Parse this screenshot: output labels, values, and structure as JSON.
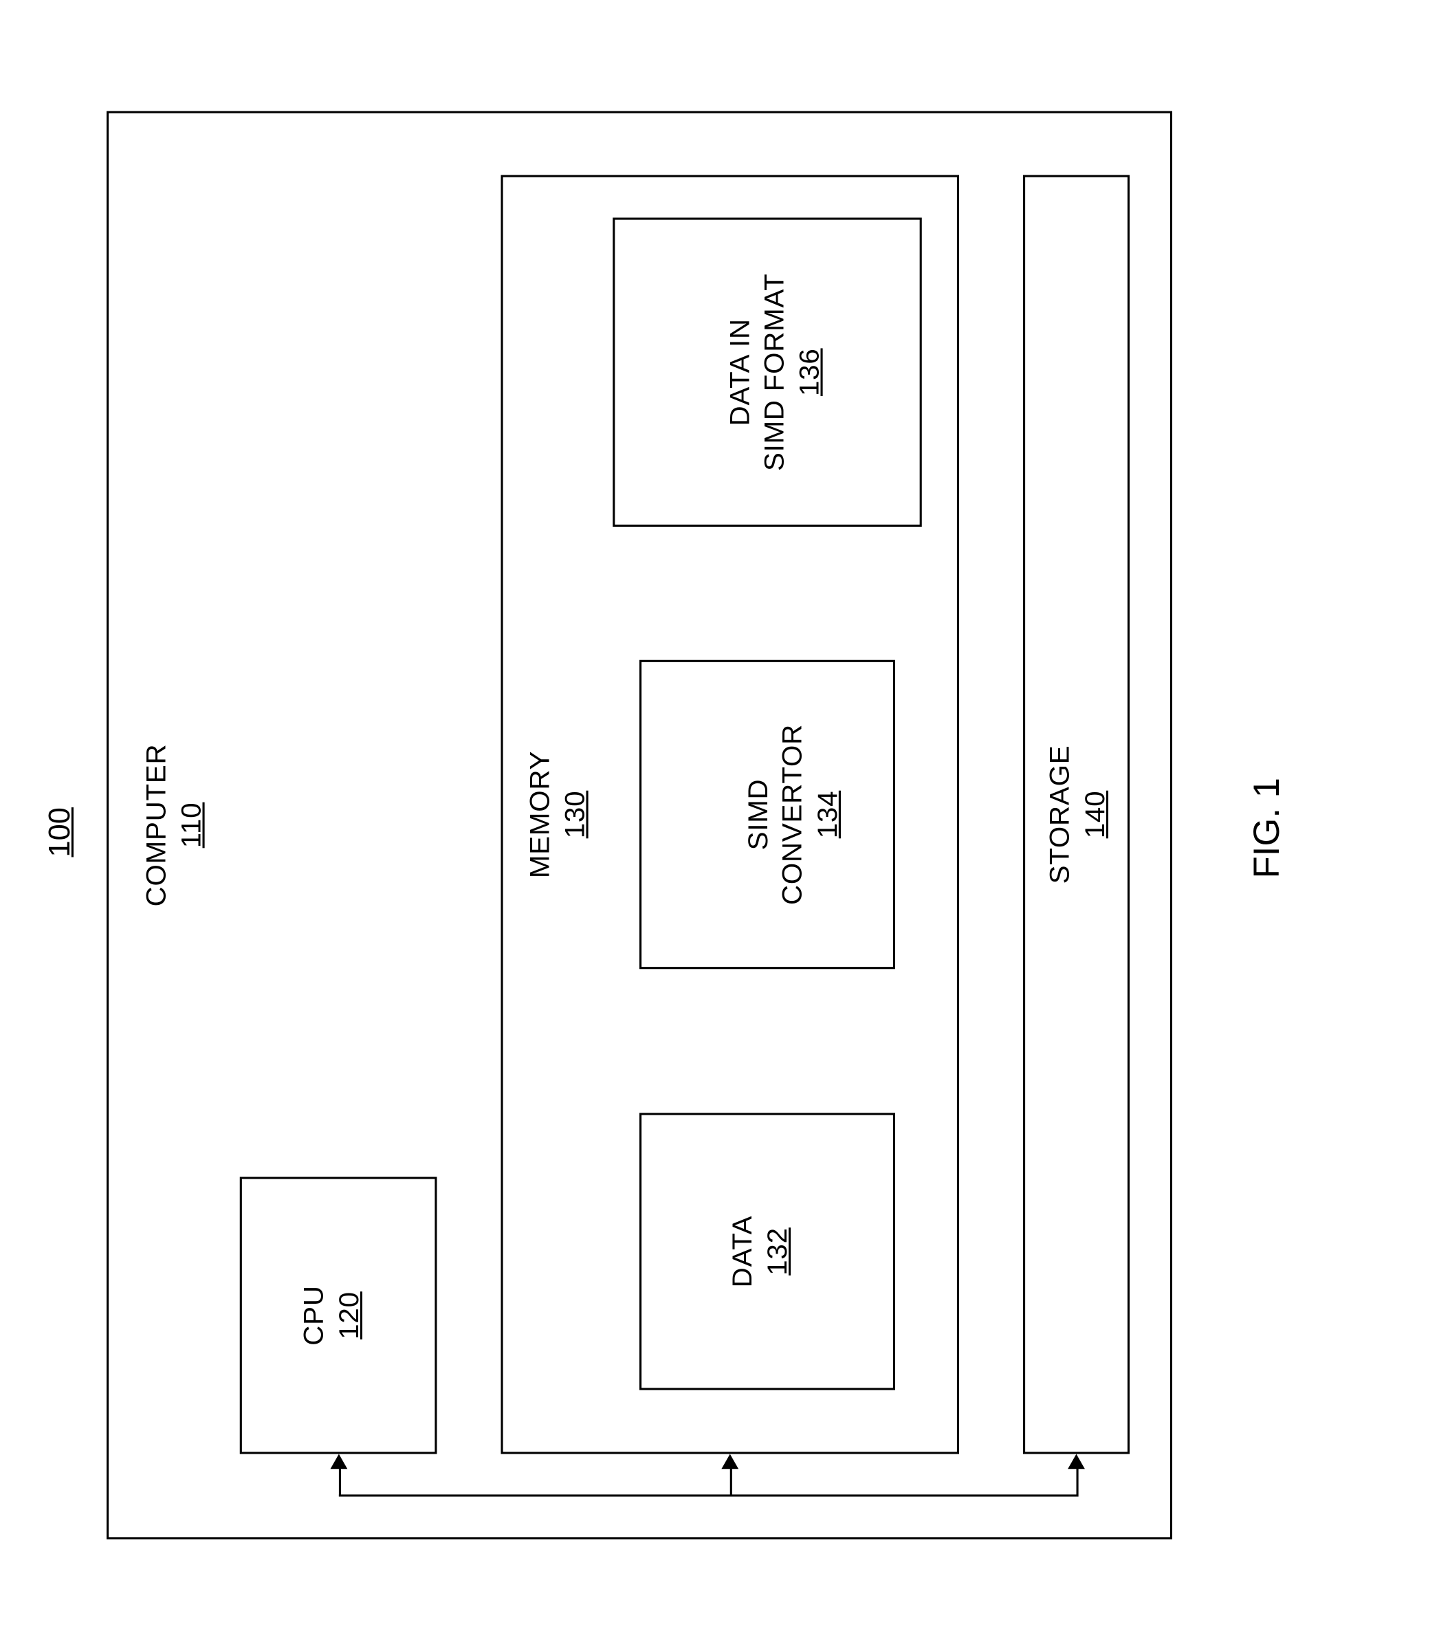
{
  "system_ref": "100",
  "computer": {
    "label": "COMPUTER",
    "ref": "110"
  },
  "cpu": {
    "label": "CPU",
    "ref": "120"
  },
  "memory": {
    "label": "MEMORY",
    "ref": "130"
  },
  "data_block": {
    "label": "DATA",
    "ref": "132"
  },
  "simd_convertor": {
    "label": "SIMD\nCONVERTOR",
    "ref": "134"
  },
  "data_simd": {
    "label": "DATA IN\nSIMD FORMAT",
    "ref": "136"
  },
  "storage": {
    "label": "STORAGE",
    "ref": "140"
  },
  "figure_label": "FIG. 1"
}
